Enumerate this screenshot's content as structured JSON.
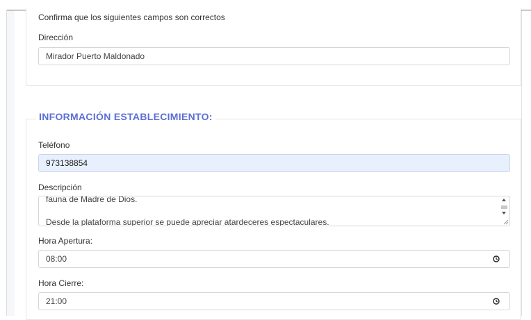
{
  "section1": {
    "intro": "Confirma que los siguientes campos son correctos",
    "direccion_label": "Dirección",
    "direccion_value": "Mirador Puerto Maldonado"
  },
  "section2": {
    "legend": "INFORMACIÓN ESTABLECIMIENTO:",
    "telefono_label": "Teléfono",
    "telefono_value": "973138854",
    "descripcion_label": "Descripción",
    "descripcion_line1": "fauna de Madre de Dios.",
    "descripcion_line2": "Desde la plataforma superior se puede apreciar atardeceres espectaculares.",
    "apertura_label": "Hora Apertura:",
    "apertura_value": "08:00",
    "cierre_label": "Hora Cierre:",
    "cierre_value": "21:00"
  },
  "colors": {
    "legend": "#5b6fd6",
    "highlight_field": "#e8f0fe"
  },
  "icons": [
    "clock-icon",
    "scroll-up-icon",
    "scroll-down-icon",
    "resize-handle-icon"
  ]
}
